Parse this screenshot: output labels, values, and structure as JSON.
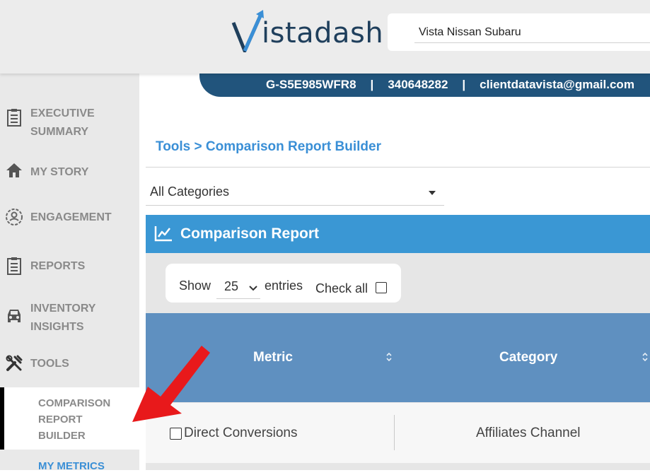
{
  "header": {
    "logo_text": "istadash",
    "dealer": "Vista Nissan Subaru"
  },
  "account": {
    "ga_id": "G-S5E985WFR8",
    "sep1": "|",
    "account_number": "340648282",
    "sep2": "|",
    "email": "clientdatavista@gmail.com"
  },
  "sidebar": {
    "items": [
      {
        "label_line1": "EXECUTIVE",
        "label_line2": "SUMMARY",
        "icon": "clipboard-icon"
      },
      {
        "label": "MY STORY",
        "icon": "home-icon"
      },
      {
        "label": "ENGAGEMENT",
        "icon": "engagement-icon"
      },
      {
        "label": "REPORTS",
        "icon": "clipboard-icon"
      },
      {
        "label_line1": "INVENTORY",
        "label_line2": "INSIGHTS",
        "icon": "car-icon"
      },
      {
        "label": "TOOLS",
        "icon": "tools-icon"
      }
    ],
    "subitems": [
      {
        "line1": "COMPARISON",
        "line2": "REPORT",
        "line3": "BUILDER"
      },
      {
        "label": "MY METRICS"
      }
    ]
  },
  "main": {
    "breadcrumb": "Tools > Comparison Report Builder",
    "category_filter": "All Categories",
    "panel_title": "Comparison Report",
    "length": {
      "show": "Show",
      "value": "25",
      "entries": "entries",
      "check_all": "Check all"
    },
    "table": {
      "columns": [
        "Metric",
        "Category"
      ],
      "rows": [
        {
          "metric": "Direct Conversions",
          "category": "Affiliates Channel",
          "checked": false
        }
      ]
    }
  },
  "colors": {
    "header_bg": "#ececec",
    "account_bar": "#21547c",
    "accent_blue": "#3a8fd6",
    "panel_blue": "#3a97d4",
    "table_head": "#5f90c0",
    "arrow_red": "#e8191b"
  }
}
